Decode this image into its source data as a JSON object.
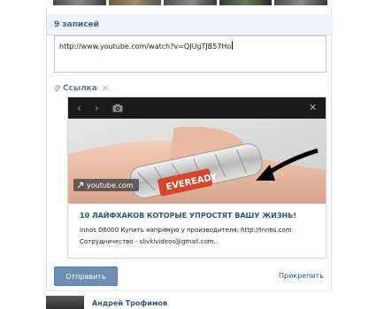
{
  "wall": {
    "records_count": "9 записей",
    "post_input_value": "http://www.youtube.com/watch?v=QJUgTJB57Ho"
  },
  "attachment": {
    "label": "Ссылка",
    "pin_icon": "paperclip-icon",
    "remove_icon": "close-icon"
  },
  "preview": {
    "source": "youtube.com",
    "title": "10 ЛАЙФХАКОВ КОТОРЫЕ УПРОСТЯТ ВАШУ ЖИЗНЬ!",
    "description_line1": "innos D6000 Купить напрямую у производителя: http://Innos.com",
    "description_line2": "Сотрудничество - slivkivideos@gmail.com..",
    "icons": [
      "chevron-left-icon",
      "chevron-right-icon",
      "camera-icon",
      "close-icon"
    ]
  },
  "actions": {
    "send_label": "Отправить",
    "attach_label": "Прикрепить"
  },
  "next_post": {
    "author": "Андрей Трофимов"
  },
  "colors": {
    "link": "#2b587a",
    "header_text": "#45688e",
    "button": "#6d8fb3",
    "header_bg": "#edf0f4"
  }
}
